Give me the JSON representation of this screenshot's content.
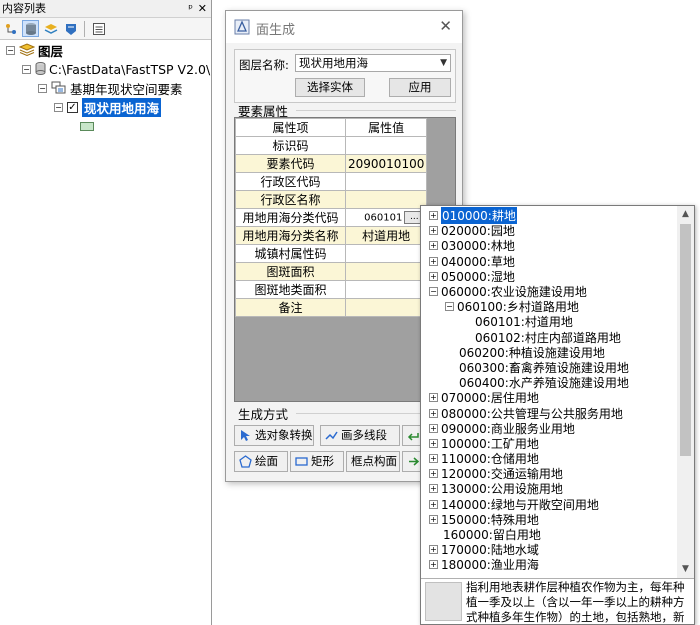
{
  "toc": {
    "title": "内容列表",
    "pin_glyph": "ᵖ",
    "close_glyph": "✕",
    "root_label": "图层",
    "db_path": "C:\\FastData\\FastTSP V2.0\\",
    "group_label": "基期年现状空间要素",
    "layer_label": "现状用地用海",
    "legend_color": "#c8e6c9"
  },
  "dialog": {
    "title": "面生成",
    "layer_name_label": "图层名称:",
    "layer_name_value": "现状用地用海",
    "select_entity_btn": "选择实体",
    "apply_btn": "应用",
    "attr_section": "要素属性",
    "col_key": "属性项",
    "col_val": "属性值",
    "rows": [
      {
        "k": "标识码",
        "v": ""
      },
      {
        "k": "要素代码",
        "v": "2090010100"
      },
      {
        "k": "行政区代码",
        "v": ""
      },
      {
        "k": "行政区名称",
        "v": ""
      },
      {
        "k": "用地用海分类代码",
        "v": "060101"
      },
      {
        "k": "用地用海分类名称",
        "v": "村道用地"
      },
      {
        "k": "城镇村属性码",
        "v": ""
      },
      {
        "k": "图斑面积",
        "v": ""
      },
      {
        "k": "图斑地类面积",
        "v": ""
      },
      {
        "k": "备注",
        "v": ""
      }
    ],
    "ellipsis": "...",
    "gen_section": "生成方式",
    "btn_convert": "选对象转换",
    "btn_polyline": "画多线段",
    "btn_draw": "绘面",
    "btn_rect": "矩形",
    "btn_vertex": "框点构面"
  },
  "dropdown": {
    "items": [
      {
        "code": "010000:耕地",
        "level": 0,
        "exp": "+"
      },
      {
        "code": "020000:园地",
        "level": 0,
        "exp": "+"
      },
      {
        "code": "030000:林地",
        "level": 0,
        "exp": "+"
      },
      {
        "code": "040000:草地",
        "level": 0,
        "exp": "+"
      },
      {
        "code": "050000:湿地",
        "level": 0,
        "exp": "+"
      },
      {
        "code": "060000:农业设施建设用地",
        "level": 0,
        "exp": "−"
      },
      {
        "code": "060100:乡村道路用地",
        "level": 1,
        "exp": "−"
      },
      {
        "code": "060101:村道用地",
        "level": 2,
        "exp": ""
      },
      {
        "code": "060102:村庄内部道路用地",
        "level": 2,
        "exp": ""
      },
      {
        "code": "060200:种植设施建设用地",
        "level": 1,
        "exp": ""
      },
      {
        "code": "060300:畜禽养殖设施建设用地",
        "level": 1,
        "exp": ""
      },
      {
        "code": "060400:水产养殖设施建设用地",
        "level": 1,
        "exp": ""
      },
      {
        "code": "070000:居住用地",
        "level": 0,
        "exp": "+"
      },
      {
        "code": "080000:公共管理与公共服务用地",
        "level": 0,
        "exp": "+"
      },
      {
        "code": "090000:商业服务业用地",
        "level": 0,
        "exp": "+"
      },
      {
        "code": "100000:工矿用地",
        "level": 0,
        "exp": "+"
      },
      {
        "code": "110000:仓储用地",
        "level": 0,
        "exp": "+"
      },
      {
        "code": "120000:交通运输用地",
        "level": 0,
        "exp": "+"
      },
      {
        "code": "130000:公用设施用地",
        "level": 0,
        "exp": "+"
      },
      {
        "code": "140000:绿地与开敞空间用地",
        "level": 0,
        "exp": "+"
      },
      {
        "code": "150000:特殊用地",
        "level": 0,
        "exp": "+"
      },
      {
        "code": "160000:留白用地",
        "level": 0,
        "exp": ""
      },
      {
        "code": "170000:陆地水域",
        "level": 0,
        "exp": "+"
      },
      {
        "code": "180000:渔业用海",
        "level": 0,
        "exp": "+"
      }
    ],
    "description": "指利用地表耕作层种植农作物为主，每年种植一季及以上（含以一年一季以上的耕种方式种植多年生作物）的土地，包括熟地，新开发、复垦、整理地，休耕"
  }
}
